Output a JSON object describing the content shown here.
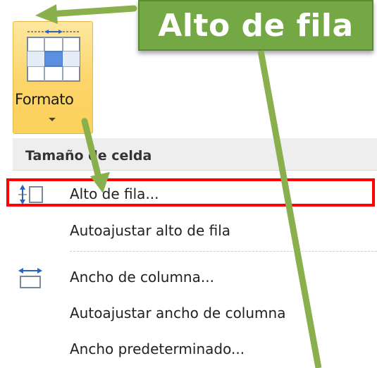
{
  "ribbon": {
    "format_button_label": "Formato"
  },
  "banner": {
    "title": "Alto de fila"
  },
  "menu": {
    "section_header": "Tamaño de celda",
    "items": [
      {
        "label": "Alto de fila...",
        "icon": "row-height-icon"
      },
      {
        "label": "Autoajustar alto de fila",
        "icon": null
      },
      {
        "label": "Ancho de columna...",
        "icon": "column-width-icon"
      },
      {
        "label": "Autoajustar ancho de columna",
        "icon": null
      },
      {
        "label": "Ancho predeterminado...",
        "icon": null
      }
    ]
  },
  "colors": {
    "banner_green": "#74a844",
    "highlight_red": "#ff0000",
    "ribbon_yellow": "#fcd569",
    "arrow_green": "#8ab04e"
  }
}
